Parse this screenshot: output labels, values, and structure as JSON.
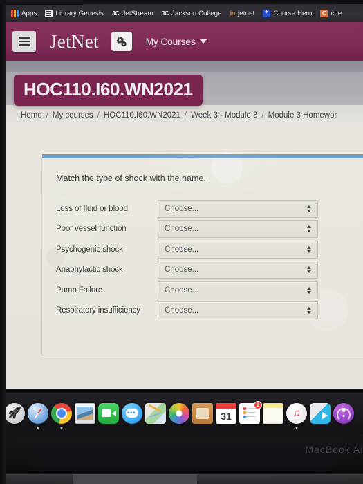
{
  "browser": {
    "bookmarks": [
      {
        "label": "Apps",
        "icon": "apps-grid-icon"
      },
      {
        "label": "Library Genesis",
        "icon": "library-genesis-icon"
      },
      {
        "label": "JetStream",
        "icon": "jc-monogram-icon"
      },
      {
        "label": "Jackson College",
        "icon": "jc-monogram-icon"
      },
      {
        "label": "jetnet",
        "icon": "in-monogram-icon"
      },
      {
        "label": "Course Hero",
        "icon": "star-icon"
      },
      {
        "label": "che",
        "icon": "c-monogram-icon"
      }
    ]
  },
  "navbar": {
    "menu_icon": "hamburger-icon",
    "brand": "JetNet",
    "gear_icon": "gears-icon",
    "my_courses_label": "My Courses",
    "caret_icon": "chevron-down-icon",
    "background_color": "#7a2450"
  },
  "course": {
    "title": "HOC110.I60.WN2021"
  },
  "breadcrumb": {
    "separator": "/",
    "items": [
      "Home",
      "My courses",
      "HOC110.I60.WN2021",
      "Week 3 - Module 3",
      "Module 3 Homewor"
    ]
  },
  "question": {
    "accent_color": "#6e9ec4",
    "prompt": "Match the type of shock with the name.",
    "select_placeholder": "Choose...",
    "rows": [
      {
        "label": "Loss of fluid or blood",
        "value": "Choose..."
      },
      {
        "label": "Poor vessel function",
        "value": "Choose..."
      },
      {
        "label": "Psychogenic shock",
        "value": "Choose..."
      },
      {
        "label": "Anaphylactic shock",
        "value": "Choose..."
      },
      {
        "label": "Pump Failure",
        "value": "Choose..."
      },
      {
        "label": "Respiratory insufficiency",
        "value": "Choose..."
      }
    ]
  },
  "dock": {
    "items": [
      {
        "name": "launchpad",
        "running": false
      },
      {
        "name": "safari",
        "running": true
      },
      {
        "name": "chrome",
        "running": true
      },
      {
        "name": "photos-app",
        "running": false
      },
      {
        "name": "facetime",
        "running": false
      },
      {
        "name": "messages",
        "running": false
      },
      {
        "name": "maps",
        "running": false
      },
      {
        "name": "photos",
        "running": false
      },
      {
        "name": "contacts",
        "running": false
      },
      {
        "name": "calendar",
        "running": false,
        "day": "31"
      },
      {
        "name": "reminders",
        "running": false,
        "badge": "2"
      },
      {
        "name": "notes",
        "running": false
      },
      {
        "name": "music",
        "running": true
      },
      {
        "name": "transfer",
        "running": false
      },
      {
        "name": "podcasts",
        "running": false
      }
    ]
  },
  "device": {
    "label": "MacBook Air"
  }
}
